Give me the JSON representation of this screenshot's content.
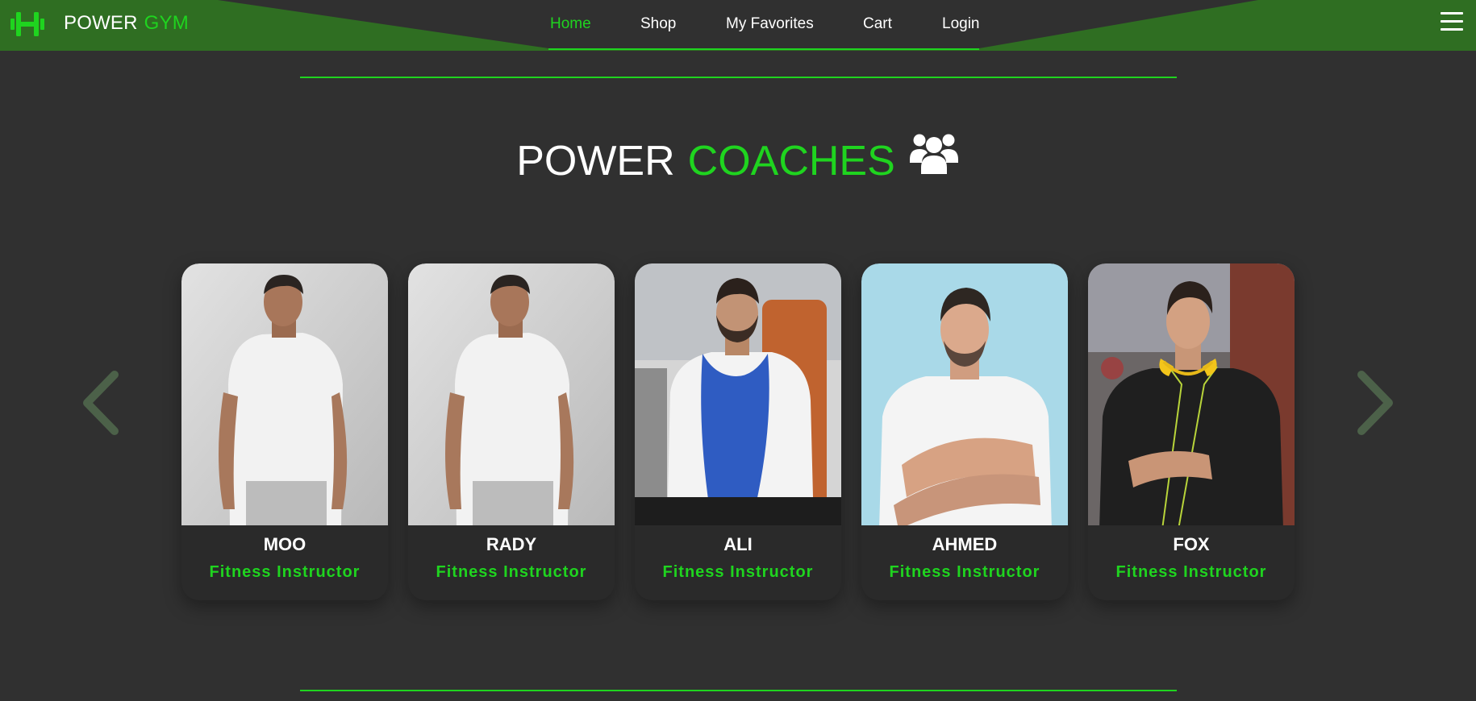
{
  "brand": {
    "word1": "POWER",
    "word2": "GYM",
    "logo_icon": "dumbbell-icon"
  },
  "nav": {
    "links": [
      {
        "label": "Home",
        "active": true
      },
      {
        "label": "Shop",
        "active": false
      },
      {
        "label": "My Favorites",
        "active": false
      },
      {
        "label": "Cart",
        "active": false
      },
      {
        "label": "Login",
        "active": false
      }
    ],
    "menu_icon": "hamburger-menu-icon"
  },
  "section": {
    "title_word1": "POWER",
    "title_word2": "COACHES",
    "title_icon": "users-group-icon"
  },
  "coaches": [
    {
      "name": "MOO",
      "role": "Fitness Instructor"
    },
    {
      "name": "RADY",
      "role": "Fitness Instructor"
    },
    {
      "name": "ALI",
      "role": "Fitness Instructor"
    },
    {
      "name": "AHMED",
      "role": "Fitness Instructor"
    },
    {
      "name": "FOX",
      "role": "Fitness Instructor"
    }
  ],
  "carousel": {
    "prev_icon": "chevron-left-icon",
    "next_icon": "chevron-right-icon"
  },
  "colors": {
    "accent": "#1fd41f",
    "header_green": "#2f6e22",
    "background": "#303030",
    "card": "#2a2a2a"
  }
}
